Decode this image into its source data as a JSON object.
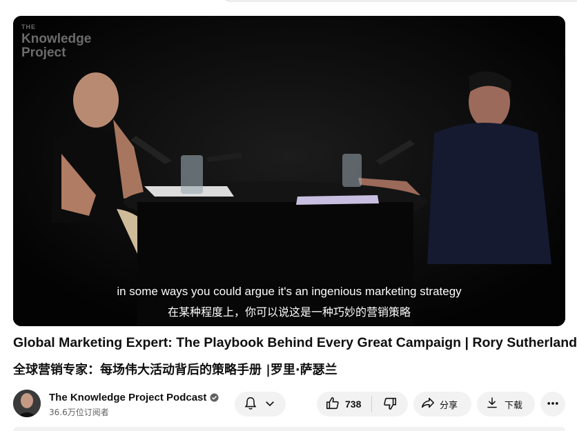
{
  "video": {
    "watermark": {
      "small": "THE",
      "line1": "Knowledge",
      "line2": "Project"
    },
    "subtitle_en": "in some ways you could argue it's an ingenious marketing strategy",
    "subtitle_zh": "在某种程度上，你可以说这是一种巧妙的营销策略"
  },
  "title": {
    "en": "Global Marketing Expert: The Playbook Behind Every Great Campaign | Rory Sutherland",
    "zh": "全球营销专家：每场伟大活动背后的策略手册 |罗里·萨瑟兰"
  },
  "channel": {
    "name": "The Knowledge Project Podcast",
    "subscribers": "36.6万位订阅者",
    "verified_icon": "verified-check-icon"
  },
  "actions": {
    "subscribe_icon": "bell-icon",
    "like_count": "738",
    "share_label": "分享",
    "download_label": "下载",
    "more_icon": "more-horiz-icon"
  },
  "colors": {
    "pill_bg": "#f2f2f2",
    "text": "#0f0f0f",
    "secondary_text": "#606060"
  }
}
